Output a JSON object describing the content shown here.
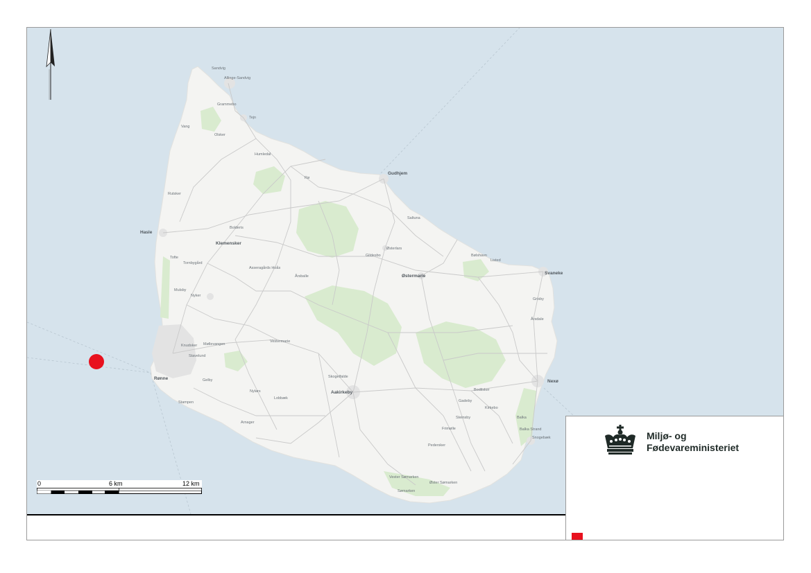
{
  "map": {
    "colors": {
      "sea": "#d6e3ec",
      "land": "#f4f4f2",
      "forest": "#d9ebcf",
      "urban": "#e3e3e3",
      "road": "#c9c9c9",
      "marker": "#e8111e"
    },
    "places": [
      {
        "id": "sandvig",
        "label": "Sandvig"
      },
      {
        "id": "allinge",
        "label": "Allinge-Sandvig"
      },
      {
        "id": "grammebo",
        "label": "Grammebo"
      },
      {
        "id": "tejn",
        "label": "Tejn"
      },
      {
        "id": "vang",
        "label": "Vang"
      },
      {
        "id": "olsker",
        "label": "Olsker"
      },
      {
        "id": "humledal",
        "label": "Humledal"
      },
      {
        "id": "gudhjem",
        "label": "Gudhjem"
      },
      {
        "id": "ro",
        "label": "Rø"
      },
      {
        "id": "rutsker",
        "label": "Rutsker"
      },
      {
        "id": "saltuna",
        "label": "Saltuna"
      },
      {
        "id": "hasle",
        "label": "Hasle"
      },
      {
        "id": "bolderis",
        "label": "Bolderis"
      },
      {
        "id": "klemensker",
        "label": "Klemensker"
      },
      {
        "id": "osterlars",
        "label": "Østerlars"
      },
      {
        "id": "gildesbo",
        "label": "Gildesbo"
      },
      {
        "id": "bolshavn",
        "label": "Bølshavn"
      },
      {
        "id": "listed",
        "label": "Listed"
      },
      {
        "id": "tofte",
        "label": "Tofte"
      },
      {
        "id": "tornbygard",
        "label": "Tornbygård"
      },
      {
        "id": "asseragard",
        "label": "Asseragårds Hoås"
      },
      {
        "id": "arsballe",
        "label": "Årsballe"
      },
      {
        "id": "ostermarie",
        "label": "Østermarie"
      },
      {
        "id": "svaneke",
        "label": "Svaneke"
      },
      {
        "id": "mulsby",
        "label": "Mulsby"
      },
      {
        "id": "nyker",
        "label": "Nyker"
      },
      {
        "id": "grisby",
        "label": "Grisby"
      },
      {
        "id": "arsdale",
        "label": "Årsdale"
      },
      {
        "id": "knudsker",
        "label": "Knudsker"
      },
      {
        "id": "mollevangen",
        "label": "Møllevangen"
      },
      {
        "id": "vestermarie",
        "label": "Vestermarie"
      },
      {
        "id": "stavelund",
        "label": "Stavelund"
      },
      {
        "id": "ronne",
        "label": "Rønne"
      },
      {
        "id": "gelby",
        "label": "Gelby"
      },
      {
        "id": "skogelfalde",
        "label": "Skogelfalde"
      },
      {
        "id": "nexo",
        "label": "Nexø"
      },
      {
        "id": "nylars",
        "label": "Nylars"
      },
      {
        "id": "lobbaek",
        "label": "Lobbæk"
      },
      {
        "id": "aakirkeby",
        "label": "Aakirkeby"
      },
      {
        "id": "bodilsker",
        "label": "Bodilsker"
      },
      {
        "id": "gadeby",
        "label": "Gadeby"
      },
      {
        "id": "kirkebo",
        "label": "Kirkebo"
      },
      {
        "id": "stampen",
        "label": "Stampen"
      },
      {
        "id": "steinsby",
        "label": "Steinsby"
      },
      {
        "id": "balka",
        "label": "Balka"
      },
      {
        "id": "balkastrand",
        "label": "Balka Strand"
      },
      {
        "id": "arnager",
        "label": "Arnager"
      },
      {
        "id": "fremolle",
        "label": "Frimølle"
      },
      {
        "id": "snogebaek",
        "label": "Snogebæk"
      },
      {
        "id": "pedersker",
        "label": "Pedersker"
      },
      {
        "id": "vestersomarken",
        "label": "Vester Sømarken"
      },
      {
        "id": "ostersomarken",
        "label": "Øster Sømarken"
      },
      {
        "id": "somarken",
        "label": "Sømarken"
      }
    ],
    "marker": {
      "icon": "location-dot-icon"
    }
  },
  "scalebar": {
    "label_0": "0",
    "label_mid": "6 km",
    "label_end": "12 km"
  },
  "north_arrow": {
    "icon": "north-arrow-icon"
  },
  "legend": {
    "ministry_line1": "Miljø- og",
    "ministry_line2": "Fødevareministeriet",
    "logo_icon": "crown-logo-icon",
    "swatch_color": "#e8111e"
  }
}
